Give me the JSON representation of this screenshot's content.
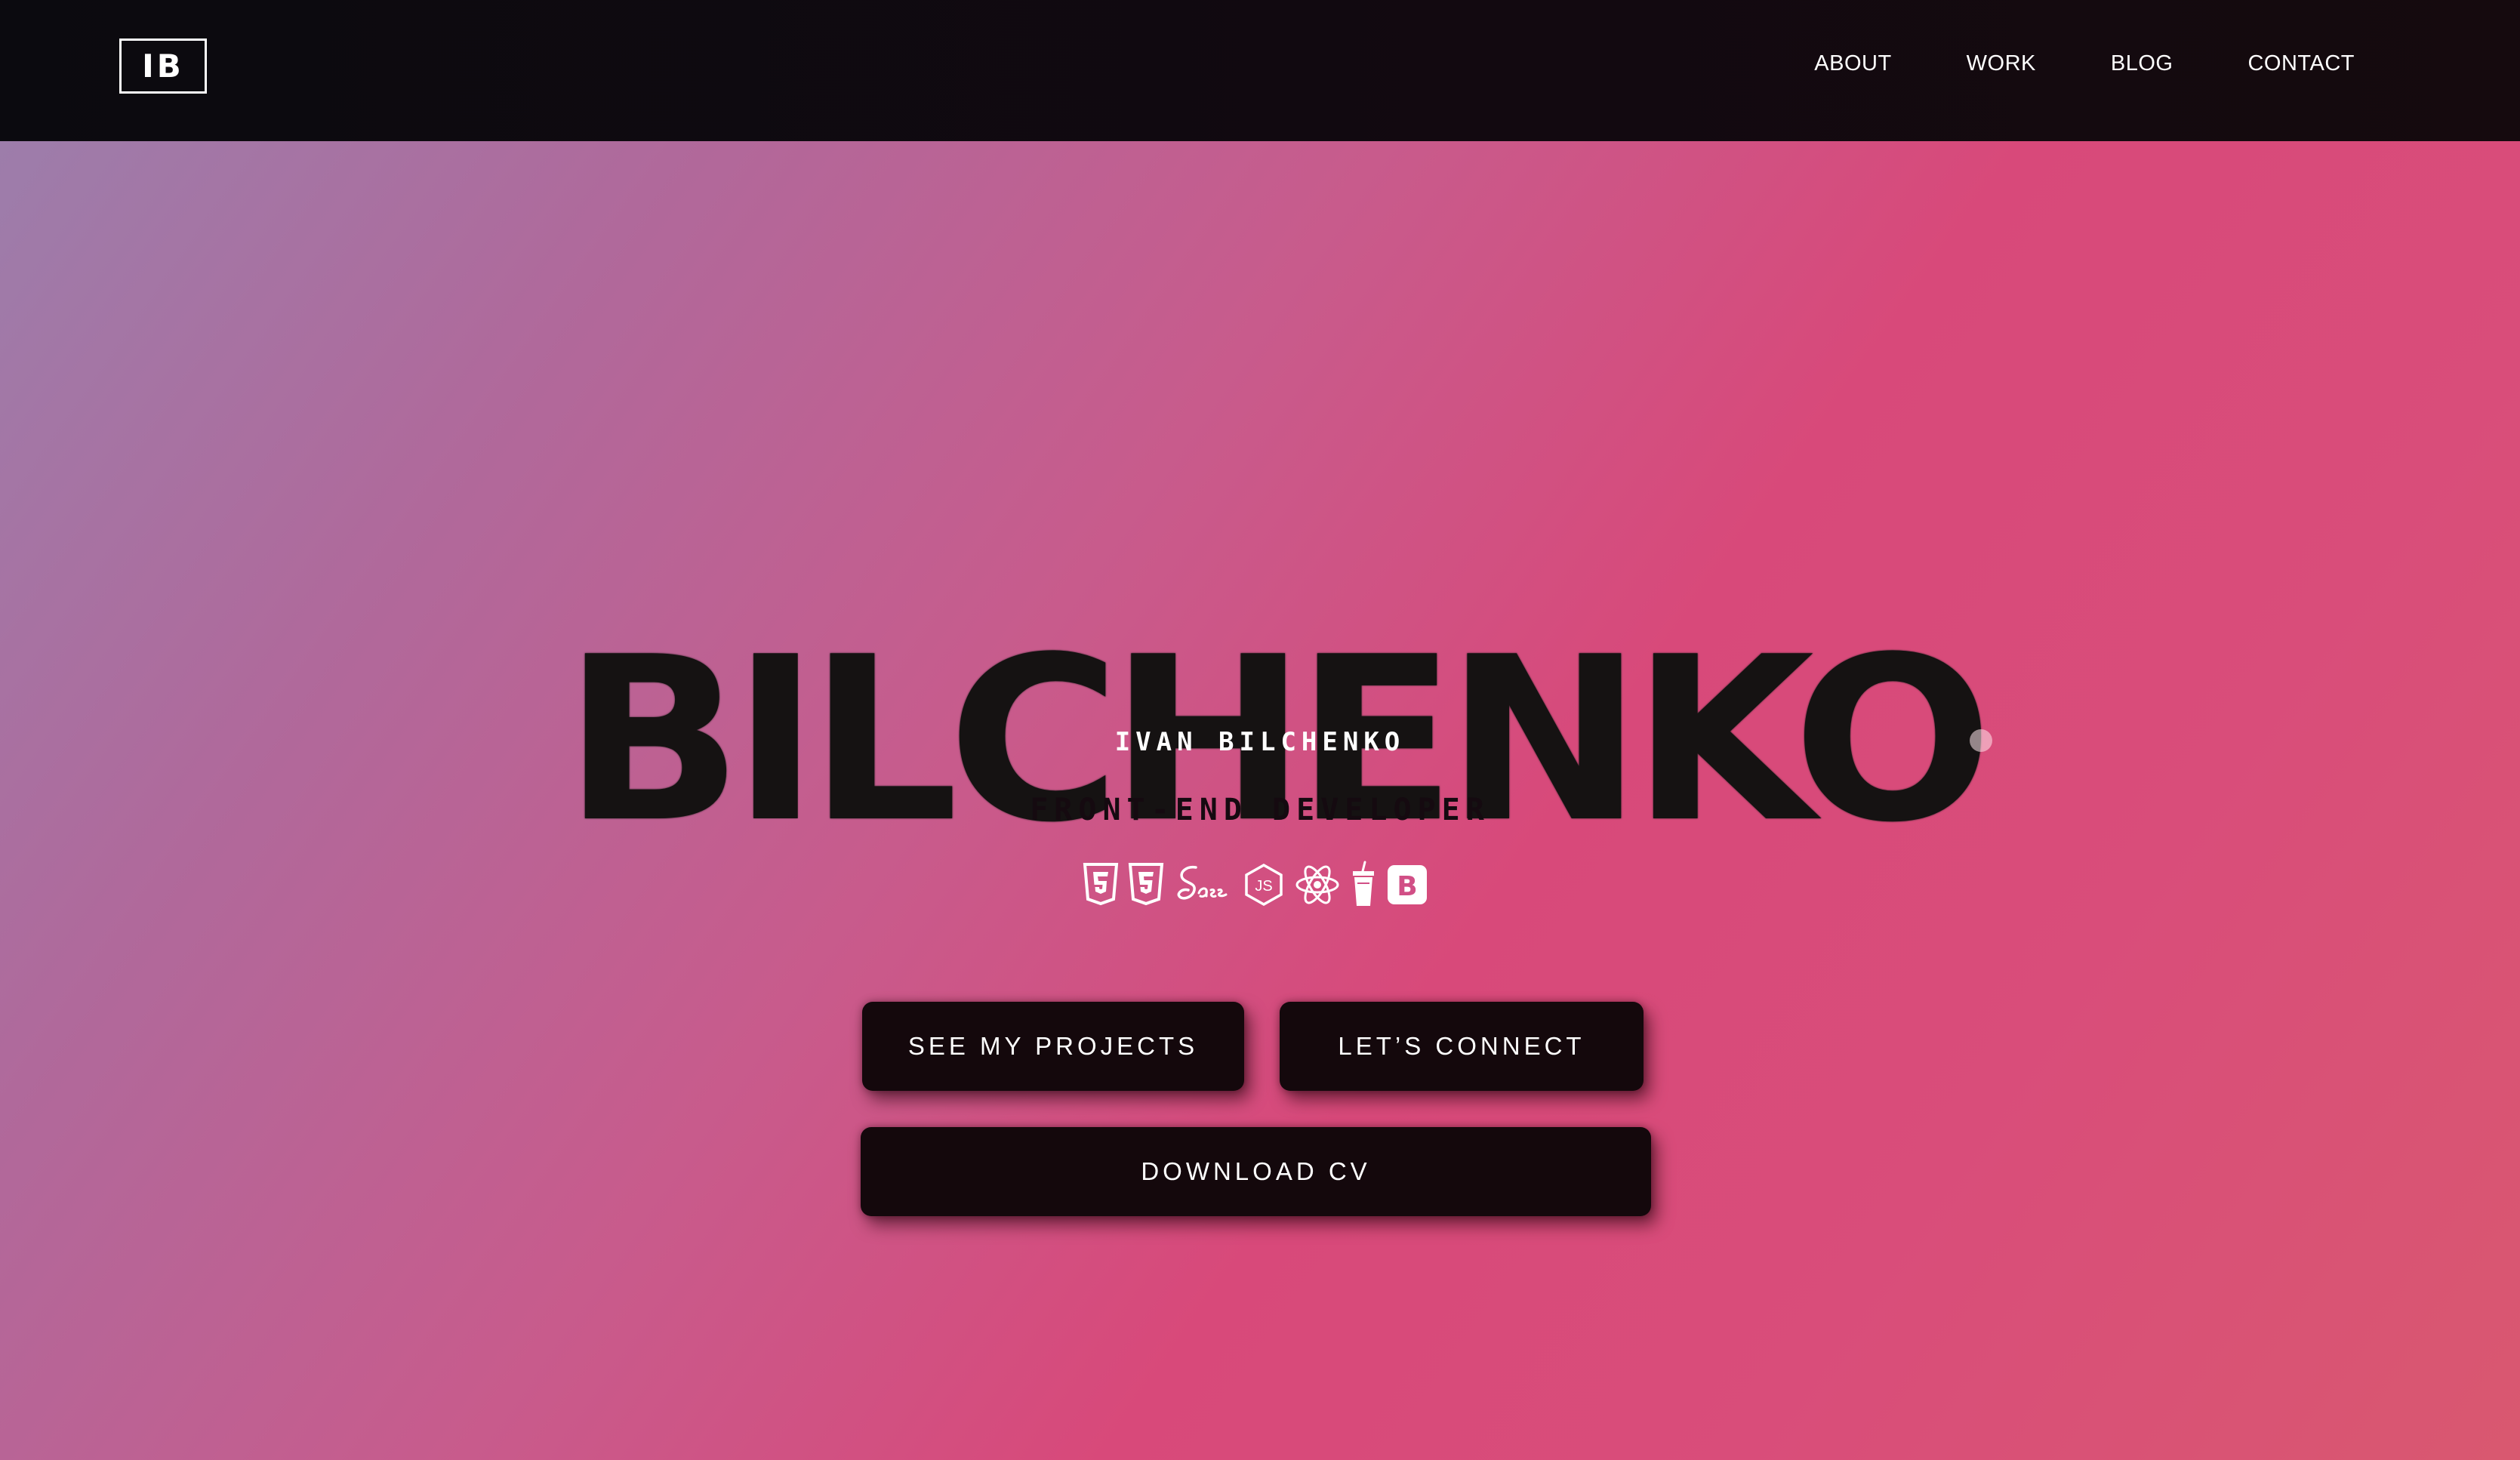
{
  "nav": {
    "logo": "IB",
    "links": [
      "ABOUT",
      "WORK",
      "BLOG",
      "CONTACT"
    ]
  },
  "hero": {
    "title": "BILCHENKO",
    "name": "IVAN BILCHENKO",
    "role": "FRONT-END DEVELOPER"
  },
  "tech_icons": [
    "html5-icon",
    "css3-icon",
    "sass-icon",
    "nodejs-icon",
    "react-icon",
    "gulp-icon",
    "bootstrap-icon"
  ],
  "buttons": {
    "projects": "SEE MY PROJECTS",
    "connect": "LET’S CONNECT",
    "cv": "DOWNLOAD CV"
  },
  "colors": {
    "nav_bg": "#0b0a0f",
    "button_bg": "#14080c",
    "gradient_start": "#9a80ad",
    "gradient_end": "#d94d7a"
  }
}
